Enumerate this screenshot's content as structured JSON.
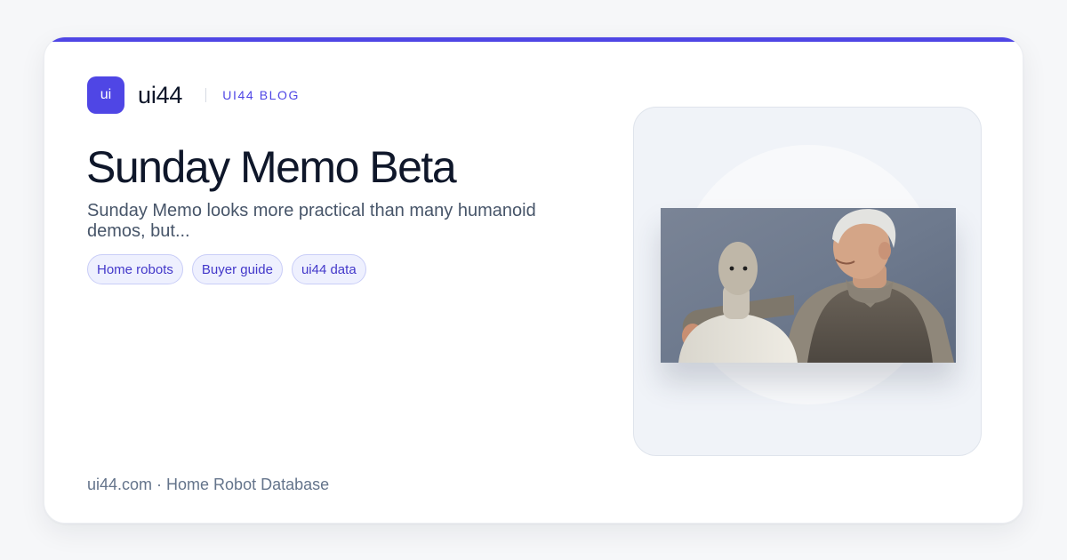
{
  "brand": {
    "logo_text": "ui",
    "name": "ui44",
    "section": "UI44 BLOG",
    "accent_color": "#4f46e5"
  },
  "post": {
    "title": "Sunday Memo Beta",
    "excerpt": "Sunday Memo looks more practical than many humanoid demos, but...",
    "tags": [
      "Home robots",
      "Buyer guide",
      "ui44 data"
    ]
  },
  "footer": {
    "text": "ui44.com · Home Robot Database"
  },
  "image": {
    "subject": "robot-and-elderly-man-photo"
  }
}
